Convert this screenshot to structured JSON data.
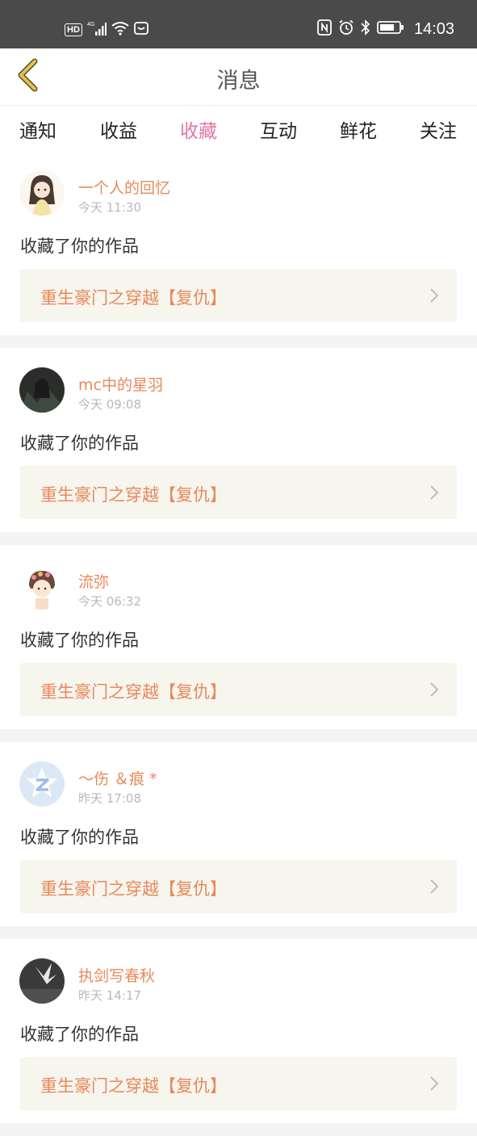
{
  "status_bar": {
    "hd": "HD",
    "network": "4G",
    "time": "14:03",
    "icons": [
      "hd-icon",
      "signal-icon",
      "wifi-icon",
      "huawei-icon",
      "nfc-icon",
      "alarm-icon",
      "bluetooth-icon",
      "battery-icon"
    ]
  },
  "header": {
    "title": "消息",
    "back_icon": "chevron-left-icon"
  },
  "tabs": [
    {
      "label": "通知",
      "active": false
    },
    {
      "label": "收益",
      "active": false
    },
    {
      "label": "收藏",
      "active": true
    },
    {
      "label": "互动",
      "active": false
    },
    {
      "label": "鲜花",
      "active": false
    },
    {
      "label": "关注",
      "active": false
    }
  ],
  "messages": [
    {
      "user": "一个人的回忆",
      "time": "今天 11:30",
      "action": "收藏了你的作品",
      "work": "重生豪门之穿越【复仇】"
    },
    {
      "user": "mc中的星羽",
      "time": "今天 09:08",
      "action": "收藏了你的作品",
      "work": "重生豪门之穿越【复仇】"
    },
    {
      "user": "流弥",
      "time": "今天 06:32",
      "action": "收藏了你的作品",
      "work": "重生豪门之穿越【复仇】"
    },
    {
      "user": "～伤 ＆痕 *",
      "time": "昨天 17:08",
      "action": "收藏了你的作品",
      "work": "重生豪门之穿越【复仇】"
    },
    {
      "user": "执剑写春秋",
      "time": "昨天 14:17",
      "action": "收藏了你的作品",
      "work": "重生豪门之穿越【复仇】"
    }
  ],
  "colors": {
    "accent_pink": "#e275a7",
    "name_orange": "#e8895a",
    "link_bg": "#f6f5ee",
    "status_bar": "#4a4a4a",
    "back_arrow": "#e6c04a"
  }
}
